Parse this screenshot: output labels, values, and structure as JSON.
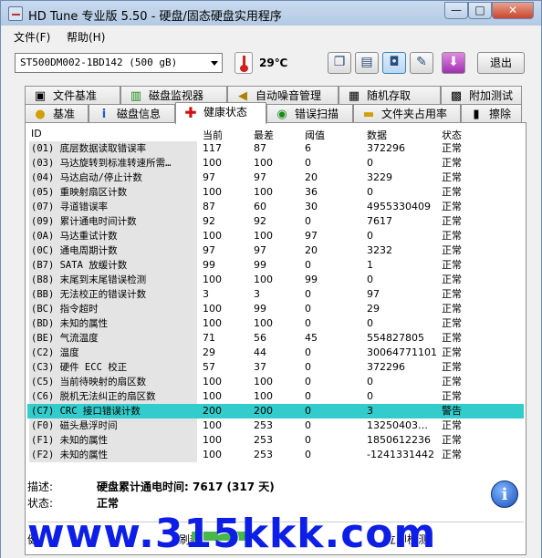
{
  "window": {
    "title": "HD Tune 专业版 5.50 - 硬盘/固态硬盘实用程序",
    "min_label": "—",
    "max_label": "□",
    "close_label": "✕"
  },
  "menu": {
    "file": "文件(F)",
    "help": "帮助(H)"
  },
  "toolbar": {
    "drive": "ST500DM002-1BD142 (500 gB)",
    "temperature": "29℃",
    "exit_label": "退出"
  },
  "tabs_top": [
    {
      "label": "文件基准",
      "icon": "file-icon"
    },
    {
      "label": "磁盘监视器",
      "icon": "chart-icon"
    },
    {
      "label": "自动噪音管理",
      "icon": "speaker-icon"
    },
    {
      "label": "随机存取",
      "icon": "disk-icon"
    },
    {
      "label": "附加测试",
      "icon": "test-icon"
    }
  ],
  "tabs_bottom": [
    {
      "label": "基准",
      "icon": "bulb-icon"
    },
    {
      "label": "磁盘信息",
      "icon": "info-icon"
    },
    {
      "label": "健康状态",
      "icon": "cross-icon"
    },
    {
      "label": "错误扫描",
      "icon": "scan-icon"
    },
    {
      "label": "文件夹占用率",
      "icon": "folder-icon"
    },
    {
      "label": "擦除",
      "icon": "trash-icon"
    }
  ],
  "table": {
    "headers": [
      "ID",
      "当前",
      "最差",
      "阈值",
      "数据",
      "状态"
    ],
    "rows": [
      [
        "(01) 底层数据读取错误率",
        "117",
        "87",
        "6",
        "372296",
        "正常"
      ],
      [
        "(03) 马达旋转到标准转速所需…",
        "100",
        "100",
        "0",
        "0",
        "正常"
      ],
      [
        "(04) 马达启动/停止计数",
        "97",
        "97",
        "20",
        "3229",
        "正常"
      ],
      [
        "(05) 重映射扇区计数",
        "100",
        "100",
        "36",
        "0",
        "正常"
      ],
      [
        "(07) 寻道错误率",
        "87",
        "60",
        "30",
        "4955330409",
        "正常"
      ],
      [
        "(09) 累计通电时间计数",
        "92",
        "92",
        "0",
        "7617",
        "正常"
      ],
      [
        "(0A) 马达重试计数",
        "100",
        "100",
        "97",
        "0",
        "正常"
      ],
      [
        "(0C) 通电周期计数",
        "97",
        "97",
        "20",
        "3232",
        "正常"
      ],
      [
        "(B7) SATA 放缓计数",
        "99",
        "99",
        "0",
        "1",
        "正常"
      ],
      [
        "(B8) 末尾到末尾错误检测",
        "100",
        "100",
        "99",
        "0",
        "正常"
      ],
      [
        "(BB) 无法校正的错误计数",
        "3",
        "3",
        "0",
        "97",
        "正常"
      ],
      [
        "(BC) 指令超时",
        "100",
        "99",
        "0",
        "29",
        "正常"
      ],
      [
        "(BD) 未知的属性",
        "100",
        "100",
        "0",
        "0",
        "正常"
      ],
      [
        "(BE) 气流温度",
        "71",
        "56",
        "45",
        "554827805",
        "正常"
      ],
      [
        "(C2) 温度",
        "29",
        "44",
        "0",
        "30064771101",
        "正常"
      ],
      [
        "(C3) 硬件 ECC 校正",
        "57",
        "37",
        "0",
        "372296",
        "正常"
      ],
      [
        "(C5) 当前待映射的扇区数",
        "100",
        "100",
        "0",
        "0",
        "正常"
      ],
      [
        "(C6) 脱机无法纠正的扇区数",
        "100",
        "100",
        "0",
        "0",
        "正常"
      ],
      [
        "(C7) CRC 接口错误计数",
        "200",
        "200",
        "0",
        "3",
        "警告"
      ],
      [
        "(F0) 磁头悬浮时间",
        "100",
        "253",
        "0",
        "13250403…",
        "正常"
      ],
      [
        "(F1) 未知的属性",
        "100",
        "253",
        "0",
        "1850612236",
        "正常"
      ],
      [
        "(F2) 未知的属性",
        "100",
        "253",
        "0",
        "-1241331442",
        "正常"
      ]
    ],
    "highlight_index": 18,
    "highlight_color": "#33cccc"
  },
  "details": {
    "desc_label": "描述:",
    "desc_value": "硬盘累计通电时间: 7617 (317 天)",
    "status_label": "状态:",
    "status_value": "正常"
  },
  "bottom": {
    "left_partial": "健",
    "mid_partial": "刷新",
    "right_partial": "立即检测"
  },
  "watermark": "www.315kkk.com"
}
